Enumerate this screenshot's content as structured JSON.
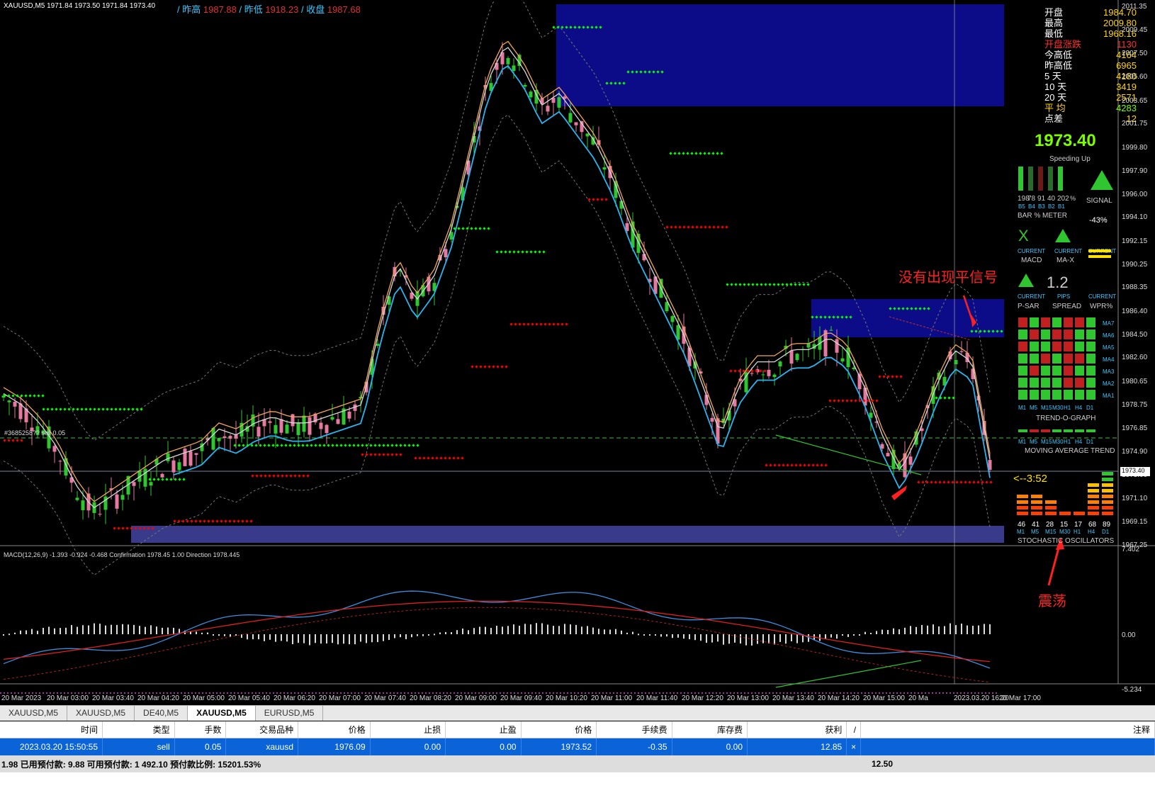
{
  "header": {
    "symbol_info": "XAUUSD,M5  1971.84 1973.50 1971.84 1973.40",
    "prev_high_label": "/ 昨高",
    "prev_high_value": "1987.88",
    "prev_low_label": "/ 昨低",
    "prev_low_value": "1918.23",
    "prev_close_label": "/ 收盘",
    "prev_close_value": "1987.68"
  },
  "price_axis": [
    "2011.35",
    "2009.45",
    "2007.50",
    "2005.60",
    "2003.65",
    "2001.75",
    "1999.80",
    "1997.90",
    "1996.00",
    "1994.10",
    "1992.15",
    "1990.25",
    "1988.35",
    "1986.40",
    "1984.50",
    "1982.60",
    "1980.65",
    "1978.75",
    "1976.85",
    "1974.90",
    "1973.40",
    "1973.00",
    "1971.10",
    "1969.15",
    "1967.25"
  ],
  "current_price_tag": "1973.40",
  "time_axis": [
    "20 Mar 2023",
    "20 Mar 03:00",
    "20 Mar 03:40",
    "20 Mar 04:20",
    "20 Mar 05:00",
    "20 Mar 05:40",
    "20 Mar 06:20",
    "20 Mar 07:00",
    "20 Mar 07:40",
    "20 Mar 08:20",
    "20 Mar 09:00",
    "20 Mar 09:40",
    "20 Mar 10:20",
    "20 Mar 11:00",
    "20 Mar 11:40",
    "20 Mar 12:20",
    "20 Mar 13:00",
    "20 Mar 13:40",
    "20 Mar 14:20",
    "20 Mar 15:00",
    "20 Ma",
    "2023.03.20 16:20",
    "20 Mar 17:00"
  ],
  "position_label": "#3685258?? sell 0.05",
  "stats": {
    "rows": [
      {
        "k": "开盘",
        "v": "1984.70"
      },
      {
        "k": "最高",
        "v": "2009.80"
      },
      {
        "k": "最低",
        "v": "1968.16"
      },
      {
        "k": "开盘涨跌",
        "v": "1130",
        "red": true
      },
      {
        "k": "今高低",
        "v": "4164"
      },
      {
        "k": "昨高低",
        "v": "6965"
      },
      {
        "k": "5  天",
        "v": "4180"
      },
      {
        "k": "10 天",
        "v": "3419"
      },
      {
        "k": "20 天",
        "v": "2571"
      },
      {
        "k": "平  均",
        "v": "4283",
        "green": true
      },
      {
        "k": "点差",
        "v": "12"
      }
    ],
    "big_price": "1973.40"
  },
  "indicators": {
    "speeding_up": "Speeding Up",
    "bar_meter_nums": [
      "198",
      "78",
      "91",
      "40",
      "202"
    ],
    "bar_meter_pct": "%",
    "bar_meter_labels": [
      "B5",
      "B4",
      "B3",
      "B2",
      "B1"
    ],
    "bar_meter_title": "BAR % METER",
    "signal": "SIGNAL",
    "signal_pct": "-43%",
    "current": "CURRENT",
    "macd": "MACD",
    "ma_x": "MA-X",
    "psar": "P-SAR",
    "spread_val": "1.2",
    "pips": "PIPS",
    "spread": "SPREAD",
    "wpr": "WPR%",
    "trend_tf": [
      "M1",
      "M5",
      "M15",
      "M30",
      "H1",
      "H4",
      "D1"
    ],
    "ma_labels": [
      "MA7",
      "MA6",
      "MA5",
      "MA4",
      "MA3",
      "MA2",
      "MA1"
    ],
    "trend_title": "TREND-O-GRAPH",
    "ma_trend_title": "MOVING AVERAGE TREND",
    "countdown": "<--3:52",
    "stoch_vals": [
      "46",
      "41",
      "28",
      "15",
      "17",
      "68",
      "89"
    ],
    "stoch_title": "STOCHASTIC OSCILLATORS"
  },
  "annotations": {
    "no_signal": "没有出现平信号",
    "oscillation": "震荡"
  },
  "macd": {
    "header": "MACD(12,26,9) -1.393 -0.924 -0.468  Confirmation 1978.45 1.00  Direction 1978.445",
    "axis_top": "7.402",
    "axis_zero": "0.00",
    "axis_bottom": "-5.234"
  },
  "tabs": [
    "XAUUSD,M5",
    "XAUUSD,M5",
    "DE40,M5",
    "XAUUSD,M5",
    "EURUSD,M5"
  ],
  "active_tab": 3,
  "table": {
    "headers": [
      "时间",
      "类型",
      "手数",
      "交易品种",
      "价格",
      "止损",
      "止盈",
      "价格",
      "手续费",
      "库存费",
      "获利",
      "/",
      "注释"
    ],
    "row": [
      "2023.03.20 15:50:55",
      "sell",
      "0.05",
      "xauusd",
      "1976.09",
      "0.00",
      "0.00",
      "1973.52",
      "-0.35",
      "0.00",
      "12.85",
      "×",
      ""
    ],
    "summary_left": "1.98  已用预付款: 9.88  可用预付款: 1 492.10  预付款比例: 15201.53%",
    "summary_profit": "12.50"
  },
  "colors": {
    "bull": "#2fc62f",
    "bear": "#e47aa0",
    "zone_top": "#0c0c88",
    "zone_bottom": "#3a3a8a"
  }
}
